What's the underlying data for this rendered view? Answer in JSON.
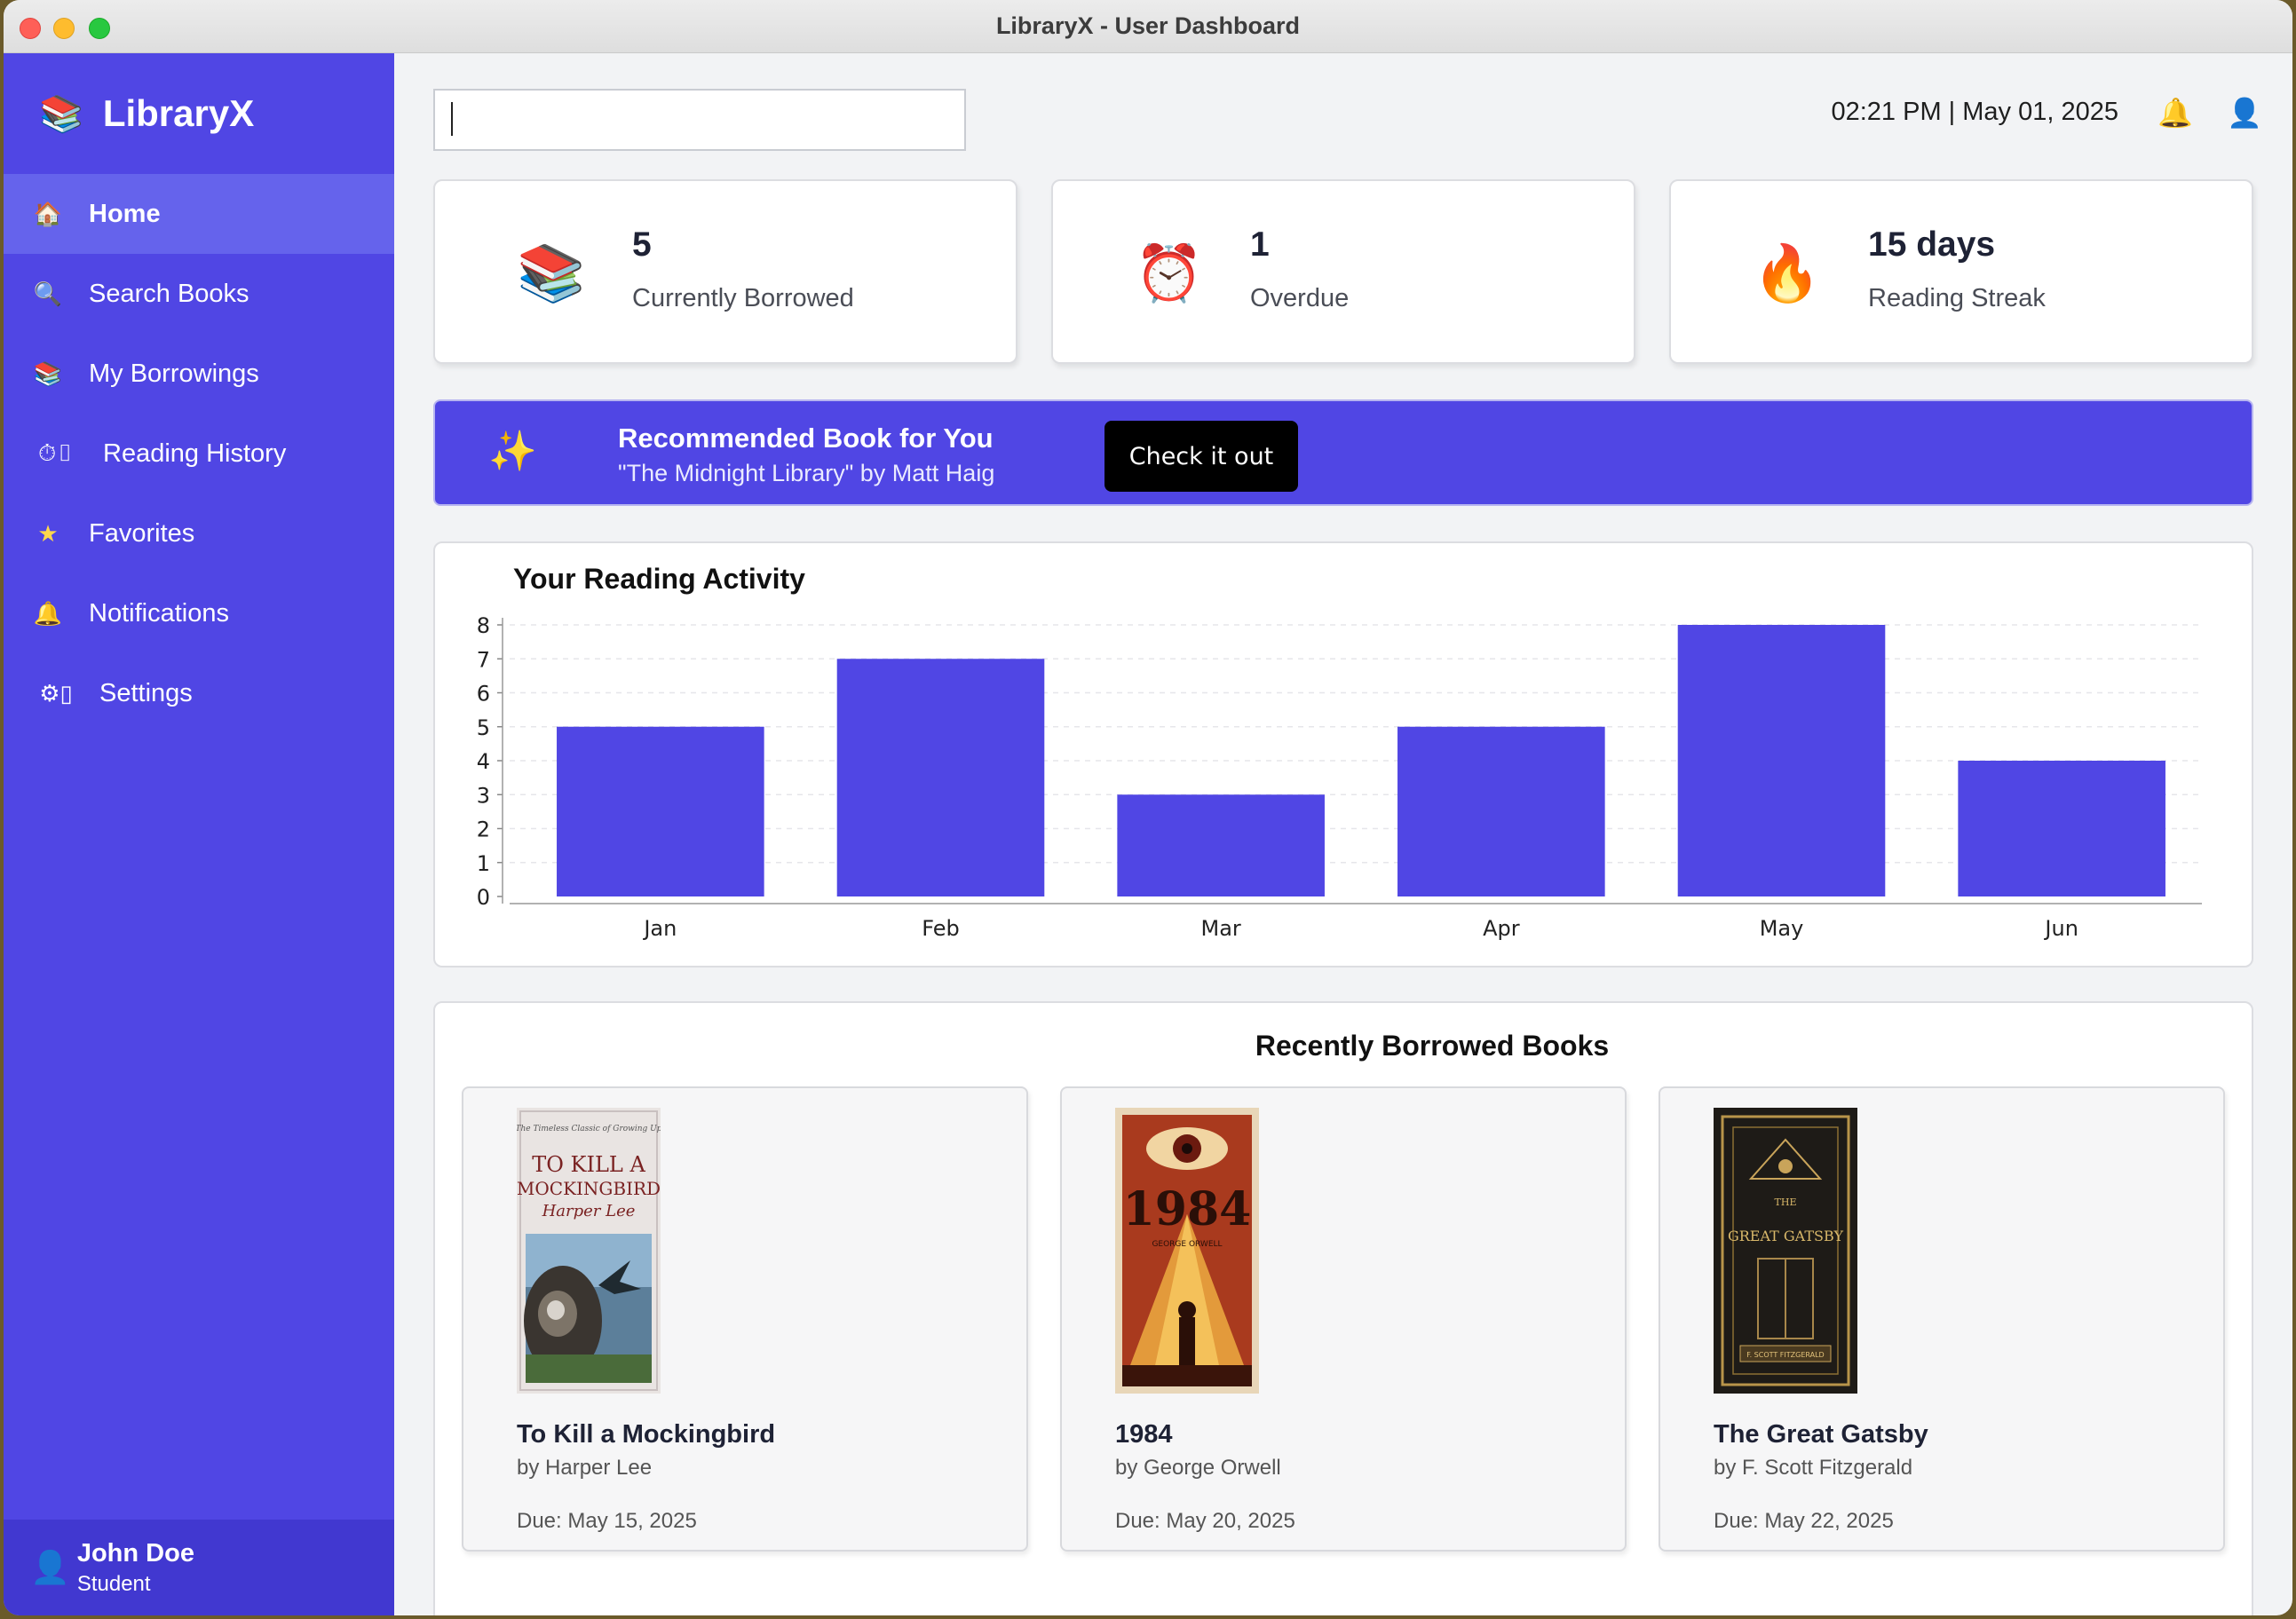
{
  "window": {
    "title": "LibraryX - User Dashboard"
  },
  "sidebar": {
    "brand": "LibraryX",
    "items": [
      {
        "label": "Home",
        "icon": "house-icon"
      },
      {
        "label": "Search Books",
        "icon": "magnifier-icon"
      },
      {
        "label": "My Borrowings",
        "icon": "books-icon"
      },
      {
        "label": "Reading History",
        "icon": "stopwatch-icon"
      },
      {
        "label": "Favorites",
        "icon": "star-icon"
      },
      {
        "label": "Notifications",
        "icon": "bell-icon"
      },
      {
        "label": "Settings",
        "icon": "gear-icon"
      }
    ],
    "user": {
      "name": "John Doe",
      "role": "Student"
    }
  },
  "header": {
    "search": {
      "value": "",
      "placeholder": ""
    },
    "datetime": "02:21 PM | May 01, 2025"
  },
  "stats": [
    {
      "value": "5",
      "label": "Currently Borrowed",
      "icon": "books-icon"
    },
    {
      "value": "1",
      "label": "Overdue",
      "icon": "alarm-clock-icon"
    },
    {
      "value": "15 days",
      "label": "Reading Streak",
      "icon": "fire-icon"
    }
  ],
  "recommendation": {
    "title": "Recommended Book for You",
    "subtitle": "\"The Midnight Library\" by Matt Haig",
    "button": "Check it out"
  },
  "activity": {
    "title": "Your Reading Activity"
  },
  "chart_data": {
    "type": "bar",
    "title": "Your Reading Activity",
    "categories": [
      "Jan",
      "Feb",
      "Mar",
      "Apr",
      "May",
      "Jun"
    ],
    "values": [
      5,
      7,
      3,
      5,
      8,
      4
    ],
    "xlabel": "",
    "ylabel": "",
    "ylim": [
      0,
      8
    ],
    "yticks": [
      "0",
      "1",
      "2",
      "3",
      "4",
      "5",
      "6",
      "7",
      "8"
    ],
    "grid": true,
    "bar_color": "#5046e4"
  },
  "recent": {
    "title": "Recently Borrowed Books",
    "books": [
      {
        "title": "To Kill a Mockingbird",
        "author": "by Harper Lee",
        "due": "Due: May 15, 2025"
      },
      {
        "title": "1984",
        "author": "by George Orwell",
        "due": "Due: May 20, 2025"
      },
      {
        "title": "The Great Gatsby",
        "author": "by F. Scott Fitzgerald",
        "due": "Due: May 22, 2025"
      }
    ]
  },
  "covers": {
    "mockingbird": {
      "line1": "TO KILL A",
      "line2": "MOCKINGBIRD",
      "line3": "Harper Lee"
    },
    "orwell": {
      "line1": "1984",
      "line2": "GEORGE ORWELL"
    },
    "gatsby": {
      "line1": "THE",
      "line2": "GREAT GATSBY",
      "line3": "F. SCOTT FITZGERALD"
    }
  },
  "colors": {
    "accent": "#5046e4",
    "sidebar": "#5046e4",
    "active_nav": "#6563ec"
  }
}
